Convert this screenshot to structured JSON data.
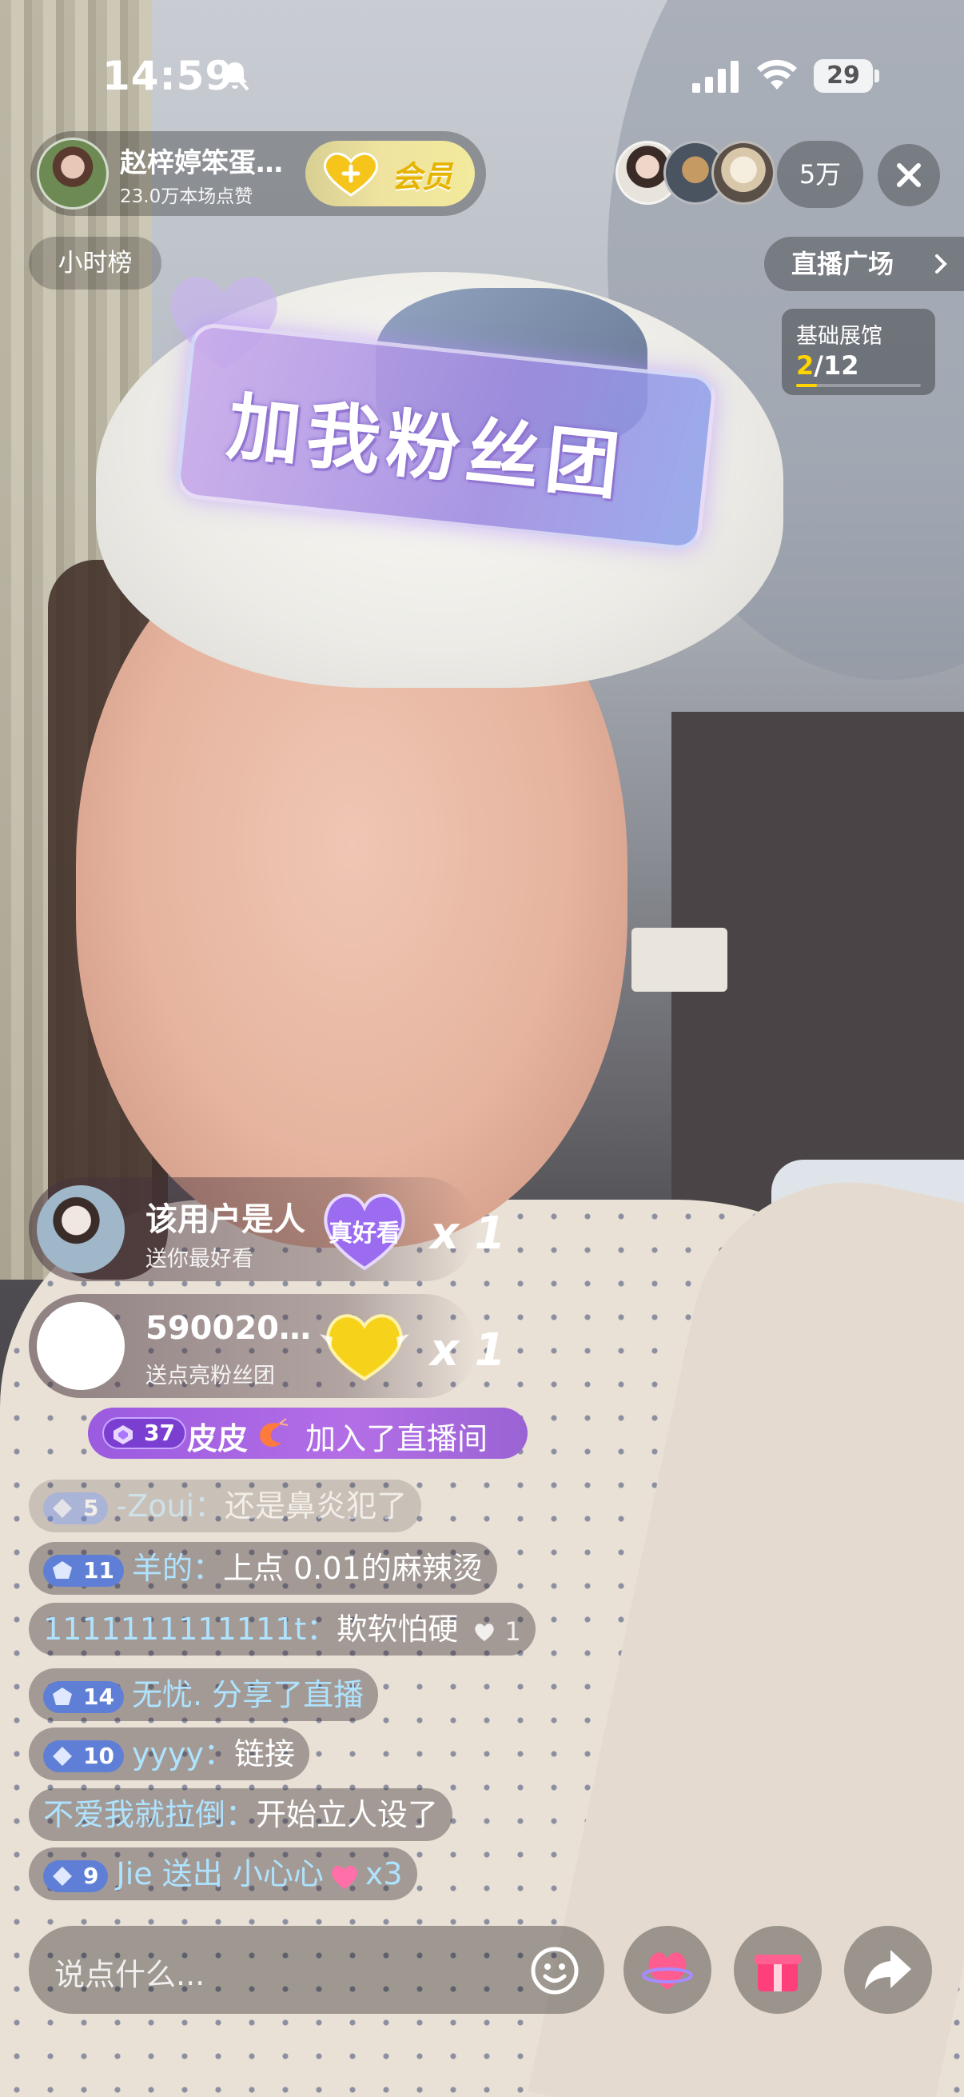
{
  "status_bar": {
    "time": "14:59",
    "battery": "29"
  },
  "host": {
    "name": "赵梓婷笨蛋…",
    "likes": "23.0万本场点赞",
    "member_label": "会员"
  },
  "audience": {
    "count": "5万"
  },
  "rank": {
    "label": "小时榜"
  },
  "plaza": {
    "label": "直播广场"
  },
  "gallery": {
    "title": "基础展馆",
    "current": "2",
    "total": "/12",
    "progress": 0.1667
  },
  "banner": {
    "text": "加我粉丝团"
  },
  "gifts": [
    {
      "user": "该用户是人",
      "action": "送你最好看",
      "multiplier": "x 1",
      "gift_icon": "heart-true-look-icon",
      "gift_caption": "真好看"
    },
    {
      "user": "590020…",
      "action": "送点亮粉丝团",
      "multiplier": "x 1",
      "gift_icon": "golden-heart-icon"
    }
  ],
  "join": {
    "level": "37",
    "user": "皮皮",
    "text": "加入了直播间"
  },
  "chat": [
    {
      "level": "5",
      "user": "-Zoui",
      "separator": "：",
      "text": "还是鼻炎犯了",
      "faded": true
    },
    {
      "level": "11",
      "user": "羊的",
      "separator": "：",
      "text": "上点 0.01的麻辣烫"
    },
    {
      "user": "1111111111111t",
      "separator": "：",
      "text": "欺软怕硬",
      "likes": "1"
    },
    {
      "level": "14",
      "user": "无忧.",
      "separator": " ",
      "text": "分享了直播",
      "text_colored": true
    },
    {
      "level": "10",
      "user": "yyyy",
      "separator": "：",
      "text": "链接"
    },
    {
      "user": "不爱我就拉倒",
      "separator": "：",
      "text": "开始立人设了"
    },
    {
      "level": "9",
      "user": "Jie",
      "separator": " ",
      "text": "送出 小心心",
      "suffix": "x3",
      "text_colored": true
    }
  ],
  "input": {
    "placeholder": "说点什么..."
  },
  "colors": {
    "level_badge": "#5f7fd6",
    "username": "#aee3ff",
    "join_pill": "#b36ee6",
    "gold": "#ffd400"
  }
}
